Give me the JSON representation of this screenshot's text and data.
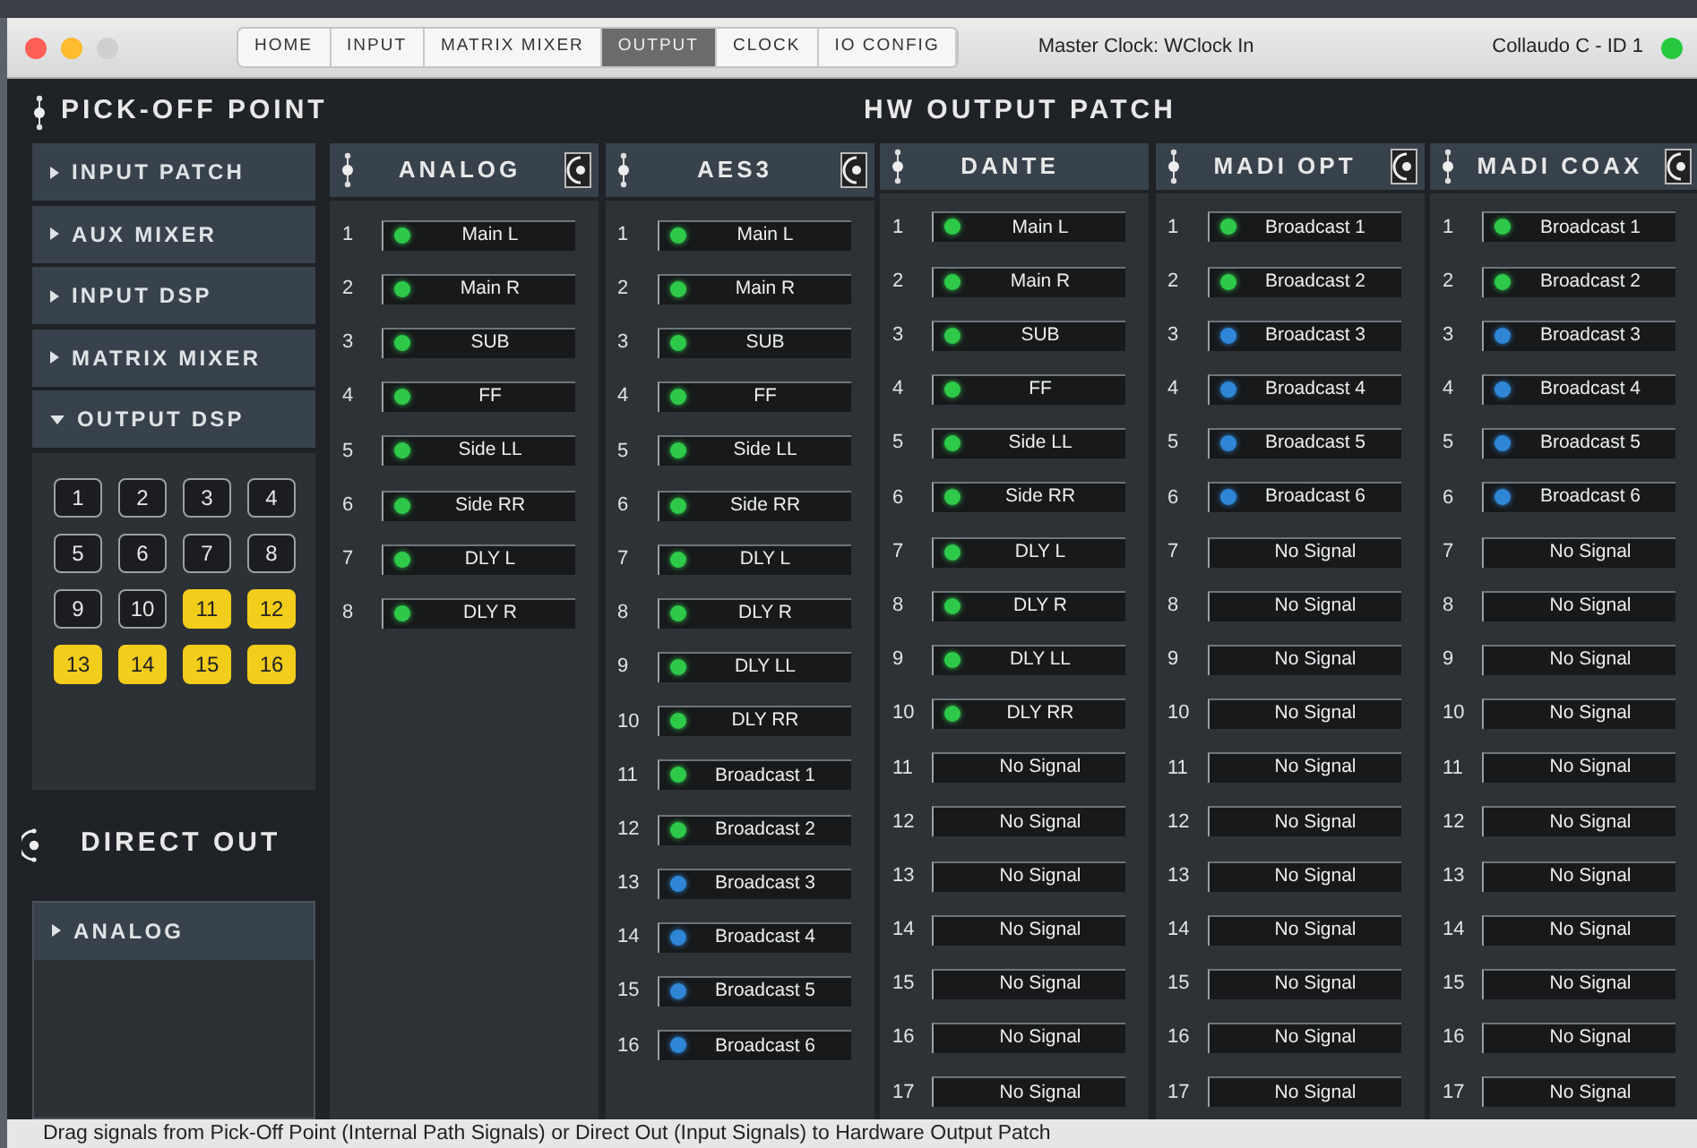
{
  "tabs": [
    {
      "label": "HOME",
      "selected": false
    },
    {
      "label": "INPUT",
      "selected": false
    },
    {
      "label": "MATRIX MIXER",
      "selected": false
    },
    {
      "label": "OUTPUT",
      "selected": true
    },
    {
      "label": "CLOCK",
      "selected": false
    },
    {
      "label": "IO CONFIG",
      "selected": false
    }
  ],
  "master_clock": "Master Clock: WClock In",
  "device": "Collaudo C - ID 1",
  "pick_off": {
    "title": "PICK-OFF POINT",
    "items": [
      {
        "label": "INPUT PATCH",
        "expanded": false
      },
      {
        "label": "AUX MIXER",
        "expanded": false
      },
      {
        "label": "INPUT DSP",
        "expanded": false
      },
      {
        "label": "MATRIX MIXER",
        "expanded": false
      },
      {
        "label": "OUTPUT DSP",
        "expanded": true,
        "channels": [
          {
            "label": "1",
            "selected": false
          },
          {
            "label": "2",
            "selected": false
          },
          {
            "label": "3",
            "selected": false
          },
          {
            "label": "4",
            "selected": false
          },
          {
            "label": "5",
            "selected": false
          },
          {
            "label": "6",
            "selected": false
          },
          {
            "label": "7",
            "selected": false
          },
          {
            "label": "8",
            "selected": false
          },
          {
            "label": "9",
            "selected": false
          },
          {
            "label": "10",
            "selected": false
          },
          {
            "label": "11",
            "selected": true
          },
          {
            "label": "12",
            "selected": true
          },
          {
            "label": "13",
            "selected": true
          },
          {
            "label": "14",
            "selected": true
          },
          {
            "label": "15",
            "selected": true
          },
          {
            "label": "16",
            "selected": true
          }
        ]
      }
    ]
  },
  "direct_out": {
    "title": "DIRECT OUT",
    "items": [
      {
        "label": "ANALOG",
        "expanded": false
      }
    ]
  },
  "patch": {
    "title": "HW OUTPUT PATCH",
    "columns": [
      {
        "name": "ANALOG",
        "selector_icon": true,
        "slots": [
          {
            "number": "1",
            "label": "Main L",
            "color": "#2fc94a"
          },
          {
            "number": "2",
            "label": "Main R",
            "color": "#2fc94a"
          },
          {
            "number": "3",
            "label": "SUB",
            "color": "#2fc94a"
          },
          {
            "number": "4",
            "label": "FF",
            "color": "#2fc94a"
          },
          {
            "number": "5",
            "label": "Side LL",
            "color": "#2fc94a"
          },
          {
            "number": "6",
            "label": "Side RR",
            "color": "#2fc94a"
          },
          {
            "number": "7",
            "label": "DLY L",
            "color": "#2fc94a"
          },
          {
            "number": "8",
            "label": "DLY R",
            "color": "#2fc94a"
          }
        ]
      },
      {
        "name": "AES3",
        "selector_icon": true,
        "slots": [
          {
            "number": "1",
            "label": "Main L",
            "color": "#2fc94a"
          },
          {
            "number": "2",
            "label": "Main R",
            "color": "#2fc94a"
          },
          {
            "number": "3",
            "label": "SUB",
            "color": "#2fc94a"
          },
          {
            "number": "4",
            "label": "FF",
            "color": "#2fc94a"
          },
          {
            "number": "5",
            "label": "Side LL",
            "color": "#2fc94a"
          },
          {
            "number": "6",
            "label": "Side RR",
            "color": "#2fc94a"
          },
          {
            "number": "7",
            "label": "DLY L",
            "color": "#2fc94a"
          },
          {
            "number": "8",
            "label": "DLY R",
            "color": "#2fc94a"
          },
          {
            "number": "9",
            "label": "DLY LL",
            "color": "#2fc94a"
          },
          {
            "number": "10",
            "label": "DLY RR",
            "color": "#2fc94a"
          },
          {
            "number": "11",
            "label": "Broadcast 1",
            "color": "#2fc94a"
          },
          {
            "number": "12",
            "label": "Broadcast 2",
            "color": "#2fc94a"
          },
          {
            "number": "13",
            "label": "Broadcast 3",
            "color": "#2f86d6"
          },
          {
            "number": "14",
            "label": "Broadcast 4",
            "color": "#2f86d6"
          },
          {
            "number": "15",
            "label": "Broadcast 5",
            "color": "#2f86d6"
          },
          {
            "number": "16",
            "label": "Broadcast 6",
            "color": "#2f86d6"
          }
        ]
      },
      {
        "name": "DANTE",
        "selector_icon": false,
        "slots": [
          {
            "number": "1",
            "label": "Main L",
            "color": "#2fc94a"
          },
          {
            "number": "2",
            "label": "Main R",
            "color": "#2fc94a"
          },
          {
            "number": "3",
            "label": "SUB",
            "color": "#2fc94a"
          },
          {
            "number": "4",
            "label": "FF",
            "color": "#2fc94a"
          },
          {
            "number": "5",
            "label": "Side LL",
            "color": "#2fc94a"
          },
          {
            "number": "6",
            "label": "Side RR",
            "color": "#2fc94a"
          },
          {
            "number": "7",
            "label": "DLY L",
            "color": "#2fc94a"
          },
          {
            "number": "8",
            "label": "DLY R",
            "color": "#2fc94a"
          },
          {
            "number": "9",
            "label": "DLY LL",
            "color": "#2fc94a"
          },
          {
            "number": "10",
            "label": "DLY RR",
            "color": "#2fc94a"
          },
          {
            "number": "11",
            "label": "No Signal"
          },
          {
            "number": "12",
            "label": "No Signal"
          },
          {
            "number": "13",
            "label": "No Signal"
          },
          {
            "number": "14",
            "label": "No Signal"
          },
          {
            "number": "15",
            "label": "No Signal"
          },
          {
            "number": "16",
            "label": "No Signal"
          },
          {
            "number": "17",
            "label": "No Signal"
          }
        ]
      },
      {
        "name": "MADI OPT",
        "selector_icon": true,
        "slots": [
          {
            "number": "1",
            "label": "Broadcast 1",
            "color": "#2fc94a"
          },
          {
            "number": "2",
            "label": "Broadcast 2",
            "color": "#2fc94a"
          },
          {
            "number": "3",
            "label": "Broadcast 3",
            "color": "#2f86d6"
          },
          {
            "number": "4",
            "label": "Broadcast 4",
            "color": "#2f86d6"
          },
          {
            "number": "5",
            "label": "Broadcast 5",
            "color": "#2f86d6"
          },
          {
            "number": "6",
            "label": "Broadcast 6",
            "color": "#2f86d6"
          },
          {
            "number": "7",
            "label": "No Signal"
          },
          {
            "number": "8",
            "label": "No Signal"
          },
          {
            "number": "9",
            "label": "No Signal"
          },
          {
            "number": "10",
            "label": "No Signal"
          },
          {
            "number": "11",
            "label": "No Signal"
          },
          {
            "number": "12",
            "label": "No Signal"
          },
          {
            "number": "13",
            "label": "No Signal"
          },
          {
            "number": "14",
            "label": "No Signal"
          },
          {
            "number": "15",
            "label": "No Signal"
          },
          {
            "number": "16",
            "label": "No Signal"
          },
          {
            "number": "17",
            "label": "No Signal"
          }
        ]
      },
      {
        "name": "MADI COAX",
        "selector_icon": true,
        "slots": [
          {
            "number": "1",
            "label": "Broadcast 1",
            "color": "#2fc94a"
          },
          {
            "number": "2",
            "label": "Broadcast 2",
            "color": "#2fc94a"
          },
          {
            "number": "3",
            "label": "Broadcast 3",
            "color": "#2f86d6"
          },
          {
            "number": "4",
            "label": "Broadcast 4",
            "color": "#2f86d6"
          },
          {
            "number": "5",
            "label": "Broadcast 5",
            "color": "#2f86d6"
          },
          {
            "number": "6",
            "label": "Broadcast 6",
            "color": "#2f86d6"
          },
          {
            "number": "7",
            "label": "No Signal"
          },
          {
            "number": "8",
            "label": "No Signal"
          },
          {
            "number": "9",
            "label": "No Signal"
          },
          {
            "number": "10",
            "label": "No Signal"
          },
          {
            "number": "11",
            "label": "No Signal"
          },
          {
            "number": "12",
            "label": "No Signal"
          },
          {
            "number": "13",
            "label": "No Signal"
          },
          {
            "number": "14",
            "label": "No Signal"
          },
          {
            "number": "15",
            "label": "No Signal"
          },
          {
            "number": "16",
            "label": "No Signal"
          },
          {
            "number": "17",
            "label": "No Signal"
          }
        ]
      }
    ]
  },
  "status_bar": "Drag signals from Pick-Off Point (Internal Path Signals) or Direct Out (Input Signals) to Hardware Output Patch"
}
